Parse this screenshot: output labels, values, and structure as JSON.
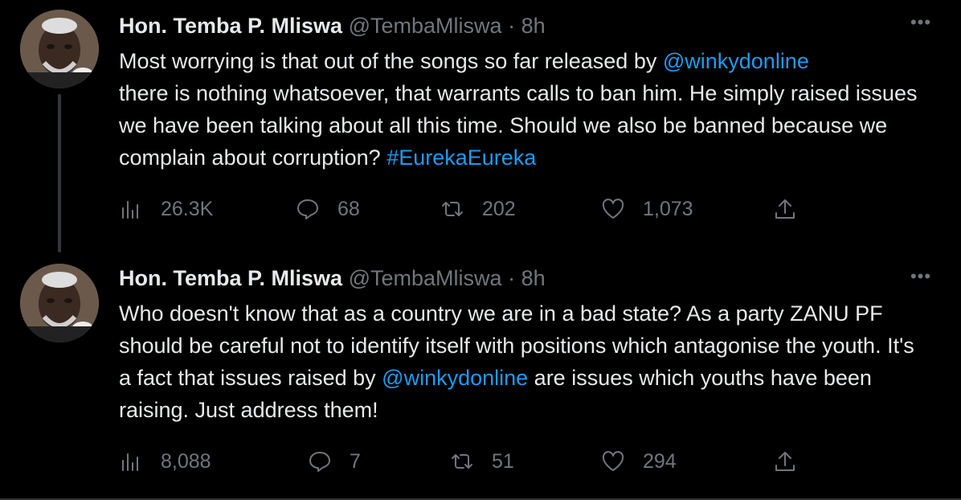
{
  "tweets": [
    {
      "author_name": "Hon. Temba P. Mliswa",
      "handle": "@TembaMliswa",
      "separator": "·",
      "time": "8h",
      "more": "•••",
      "text_parts": [
        "Most worrying is that out of the songs so far released by ",
        "@winkydonline",
        "there is nothing whatsoever, that warrants calls to ban him. He simply raised issues we have been talking about all this time. Should we also be banned because we complain about corruption? ",
        "#EurekaEureka"
      ],
      "stats": {
        "views": "26.3K",
        "replies": "68",
        "retweets": "202",
        "likes": "1,073"
      },
      "avatar": "profile-photo"
    },
    {
      "author_name": "Hon. Temba P. Mliswa",
      "handle": "@TembaMliswa",
      "separator": "·",
      "time": "8h",
      "more": "•••",
      "text_parts": [
        "Who doesn't know that as a country we are in a bad state? As a party ZANU PF should be careful not to identify itself with positions which antagonise the youth. It's a fact that issues raised by ",
        "@winkydonline",
        " are issues which youths have been raising. Just address them!"
      ],
      "stats": {
        "views": "8,088",
        "replies": "7",
        "retweets": "51",
        "likes": "294"
      },
      "avatar": "profile-photo"
    }
  ],
  "icons": {
    "views": "bar-chart-icon",
    "reply": "speech-bubble-icon",
    "retweet": "retweet-arrows-icon",
    "like": "heart-icon",
    "share": "upload-arrow-icon",
    "more": "ellipsis-icon"
  },
  "colors": {
    "background": "#000000",
    "text": "#e7e9ea",
    "muted": "#71767b",
    "link": "#1d9bf0"
  }
}
